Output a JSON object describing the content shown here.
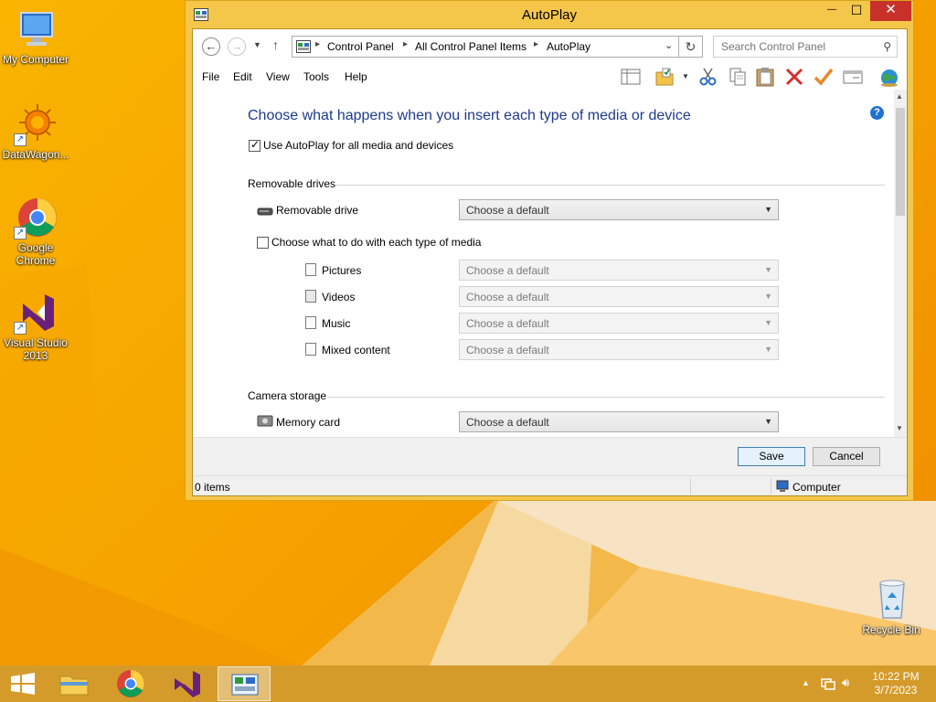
{
  "desktop": {
    "icons": [
      {
        "label": "My Computer"
      },
      {
        "label": "DataWagon..."
      },
      {
        "label": "Google Chrome"
      },
      {
        "label": "Visual Studio 2013"
      },
      {
        "label": "Recycle Bin"
      }
    ]
  },
  "window": {
    "title": "AutoPlay",
    "controls": {
      "minimize": "—",
      "maximize": "☐",
      "close": "✕"
    }
  },
  "address": {
    "crumbs": [
      "Control Panel",
      "All Control Panel Items",
      "AutoPlay"
    ],
    "search_placeholder": "Search Control Panel"
  },
  "menu": {
    "items": [
      "File",
      "Edit",
      "View",
      "Tools",
      "Help"
    ],
    "toolbar_icons": [
      "layout-icon",
      "folder-options-icon",
      "cut-icon",
      "copy-icon",
      "paste-icon",
      "delete-icon",
      "check-icon",
      "properties-icon",
      "globe-icon"
    ]
  },
  "content": {
    "heading": "Choose what happens when you insert each type of media or device",
    "use_autoplay": {
      "label": "Use AutoPlay for all media and devices",
      "checked": true
    },
    "removable": {
      "section": "Removable drives",
      "drive_label": "Removable drive",
      "drive_value": "Choose a default",
      "per_media": {
        "label": "Choose what to do with each type of media",
        "checked": false
      },
      "media": [
        {
          "label": "Pictures",
          "value": "Choose a default"
        },
        {
          "label": "Videos",
          "value": "Choose a default"
        },
        {
          "label": "Music",
          "value": "Choose a default"
        },
        {
          "label": "Mixed content",
          "value": "Choose a default"
        }
      ]
    },
    "camera": {
      "section": "Camera storage",
      "card_label": "Memory card",
      "card_value": "Choose a default"
    }
  },
  "footer": {
    "save": "Save",
    "cancel": "Cancel"
  },
  "status": {
    "items": "0 items",
    "zone": "Computer"
  },
  "taskbar": {
    "time": "10:22 PM",
    "date": "3/7/2023"
  }
}
